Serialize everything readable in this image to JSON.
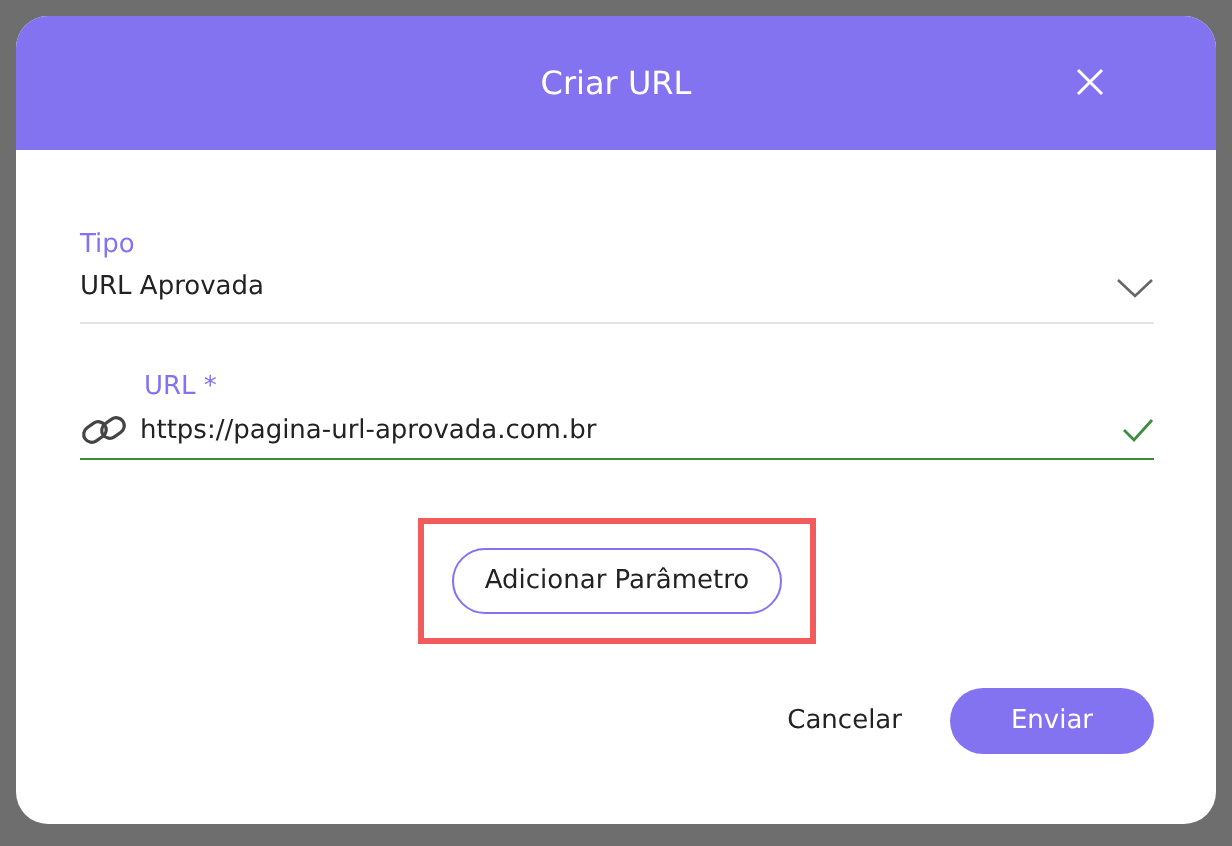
{
  "dialog": {
    "title": "Criar URL"
  },
  "type_field": {
    "label": "Tipo",
    "value": "URL Aprovada"
  },
  "url_field": {
    "label": "URL *",
    "value": "https://pagina-url-aprovada.com.br",
    "valid": true
  },
  "add_parameter_button": {
    "label": "Adicionar Parâmetro",
    "highlighted": true
  },
  "buttons": [
    {
      "label": "Cancelar",
      "kind": "text"
    },
    {
      "label": "Enviar",
      "kind": "primary"
    }
  ]
}
